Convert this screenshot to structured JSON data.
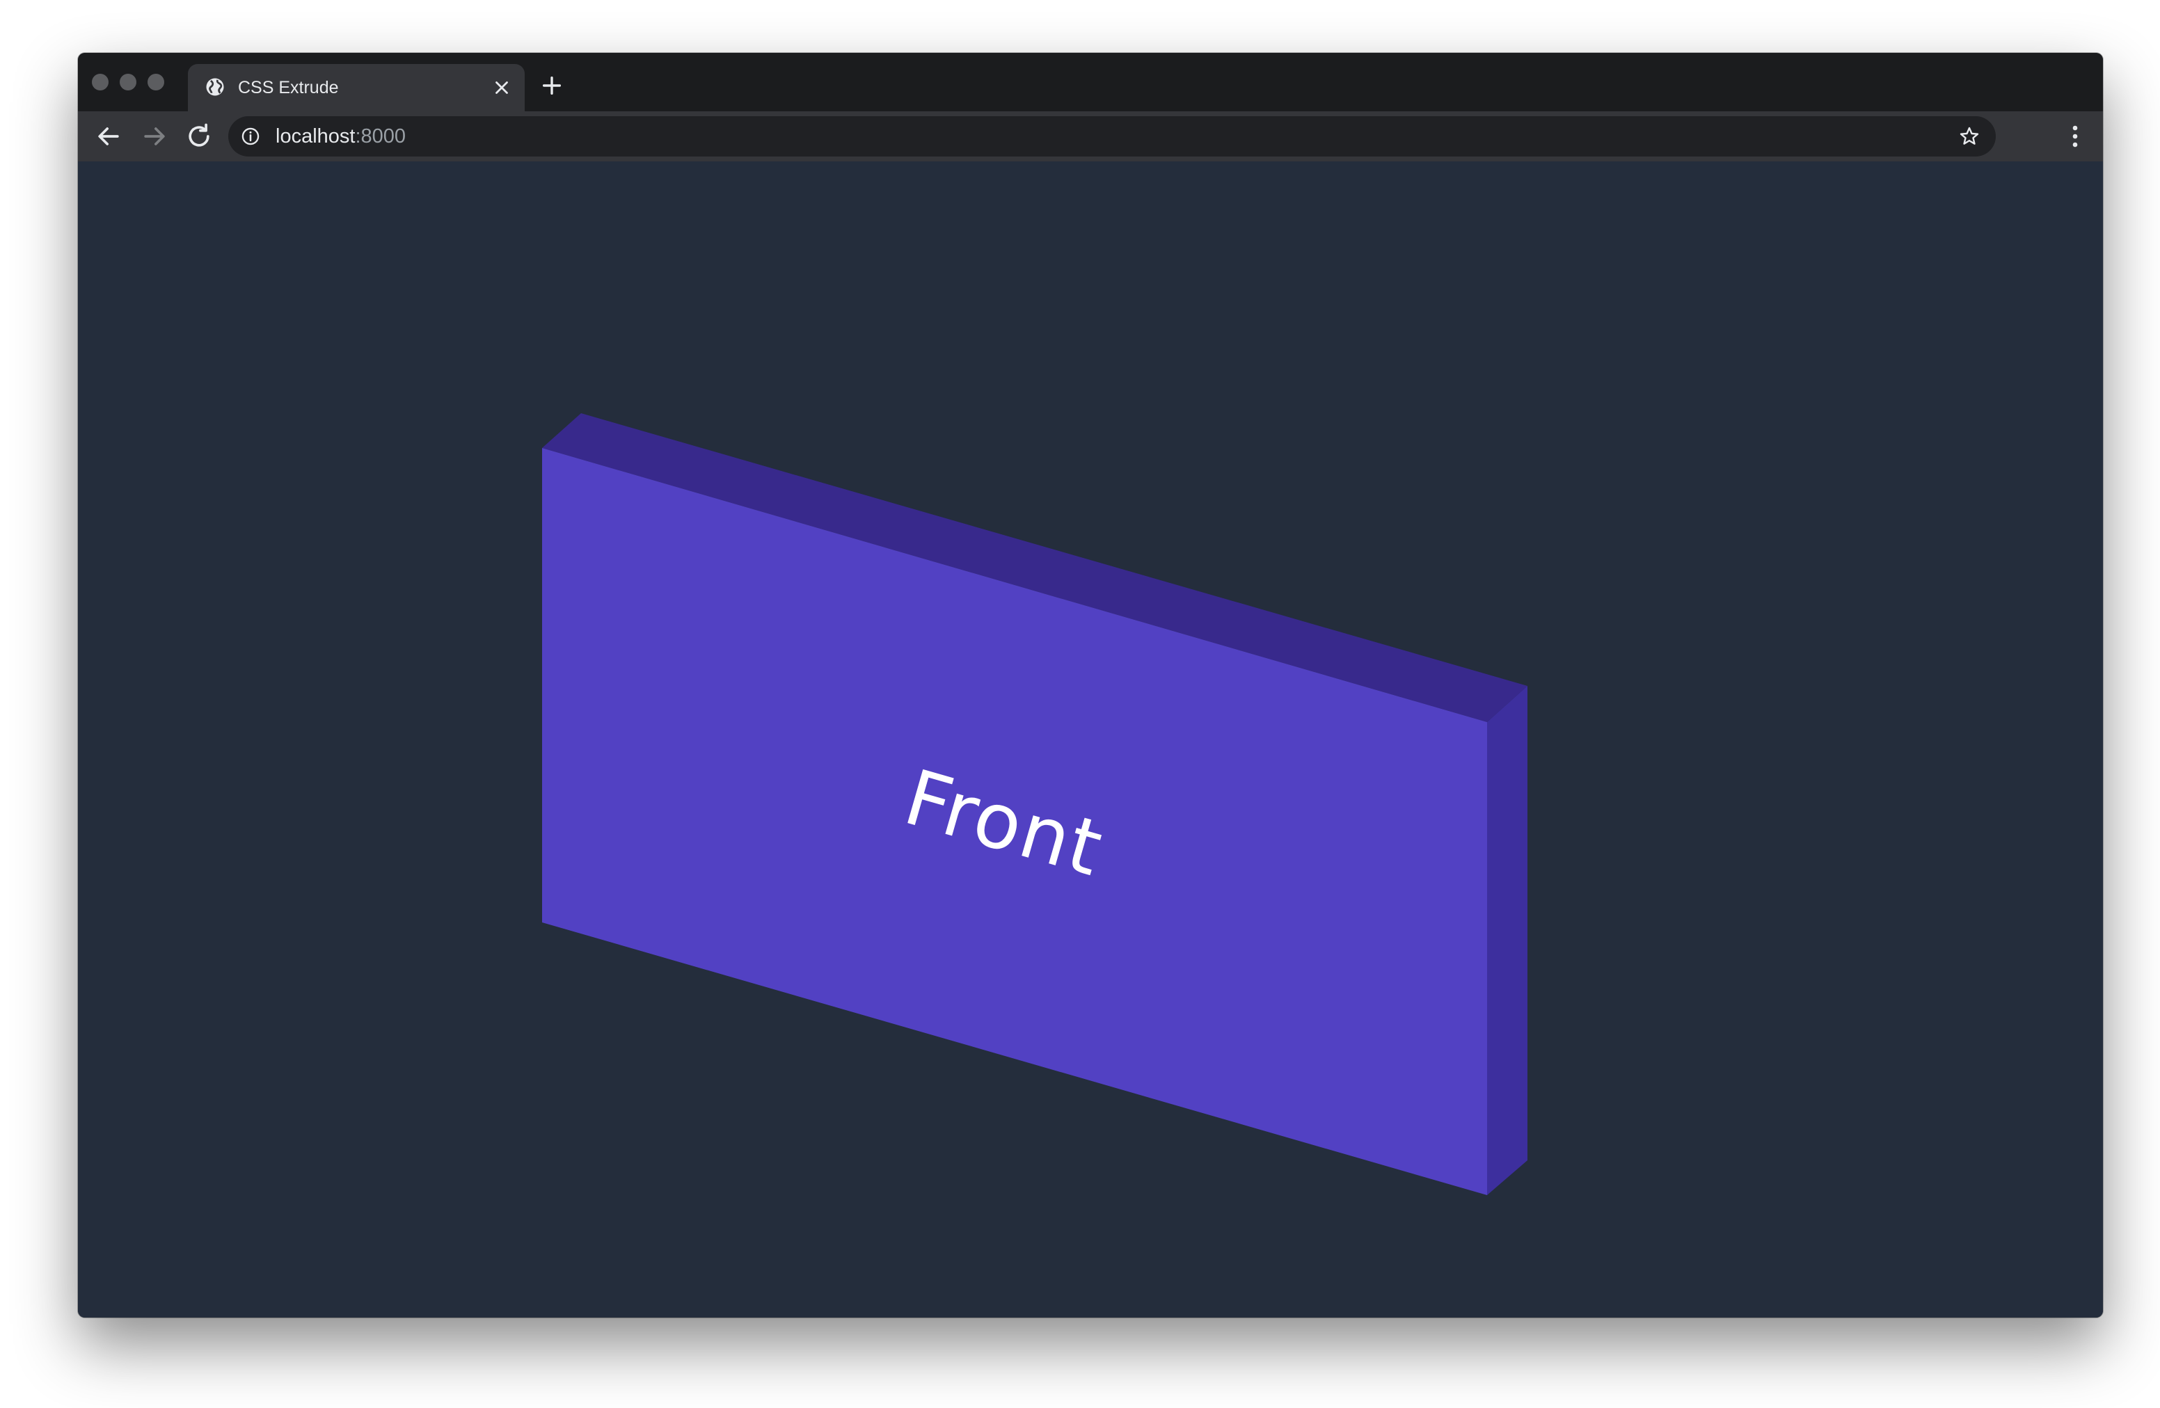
{
  "browser": {
    "tab": {
      "title": "CSS Extrude",
      "favicon": "globe-icon"
    },
    "new_tab_icon": "plus-icon",
    "toolbar": {
      "back_icon": "arrow-left-icon",
      "forward_icon": "arrow-right-icon",
      "reload_icon": "reload-icon",
      "url_host": "localhost",
      "url_port": ":8000",
      "site_info_icon": "info-icon",
      "bookmark_icon": "star-icon",
      "menu_icon": "kebab-menu-icon"
    }
  },
  "page": {
    "background_color": "#242d3c",
    "box": {
      "front_label": "Front",
      "front_color": "#5241c3",
      "top_color": "#38298c",
      "side_color": "#3d2f9e"
    }
  }
}
